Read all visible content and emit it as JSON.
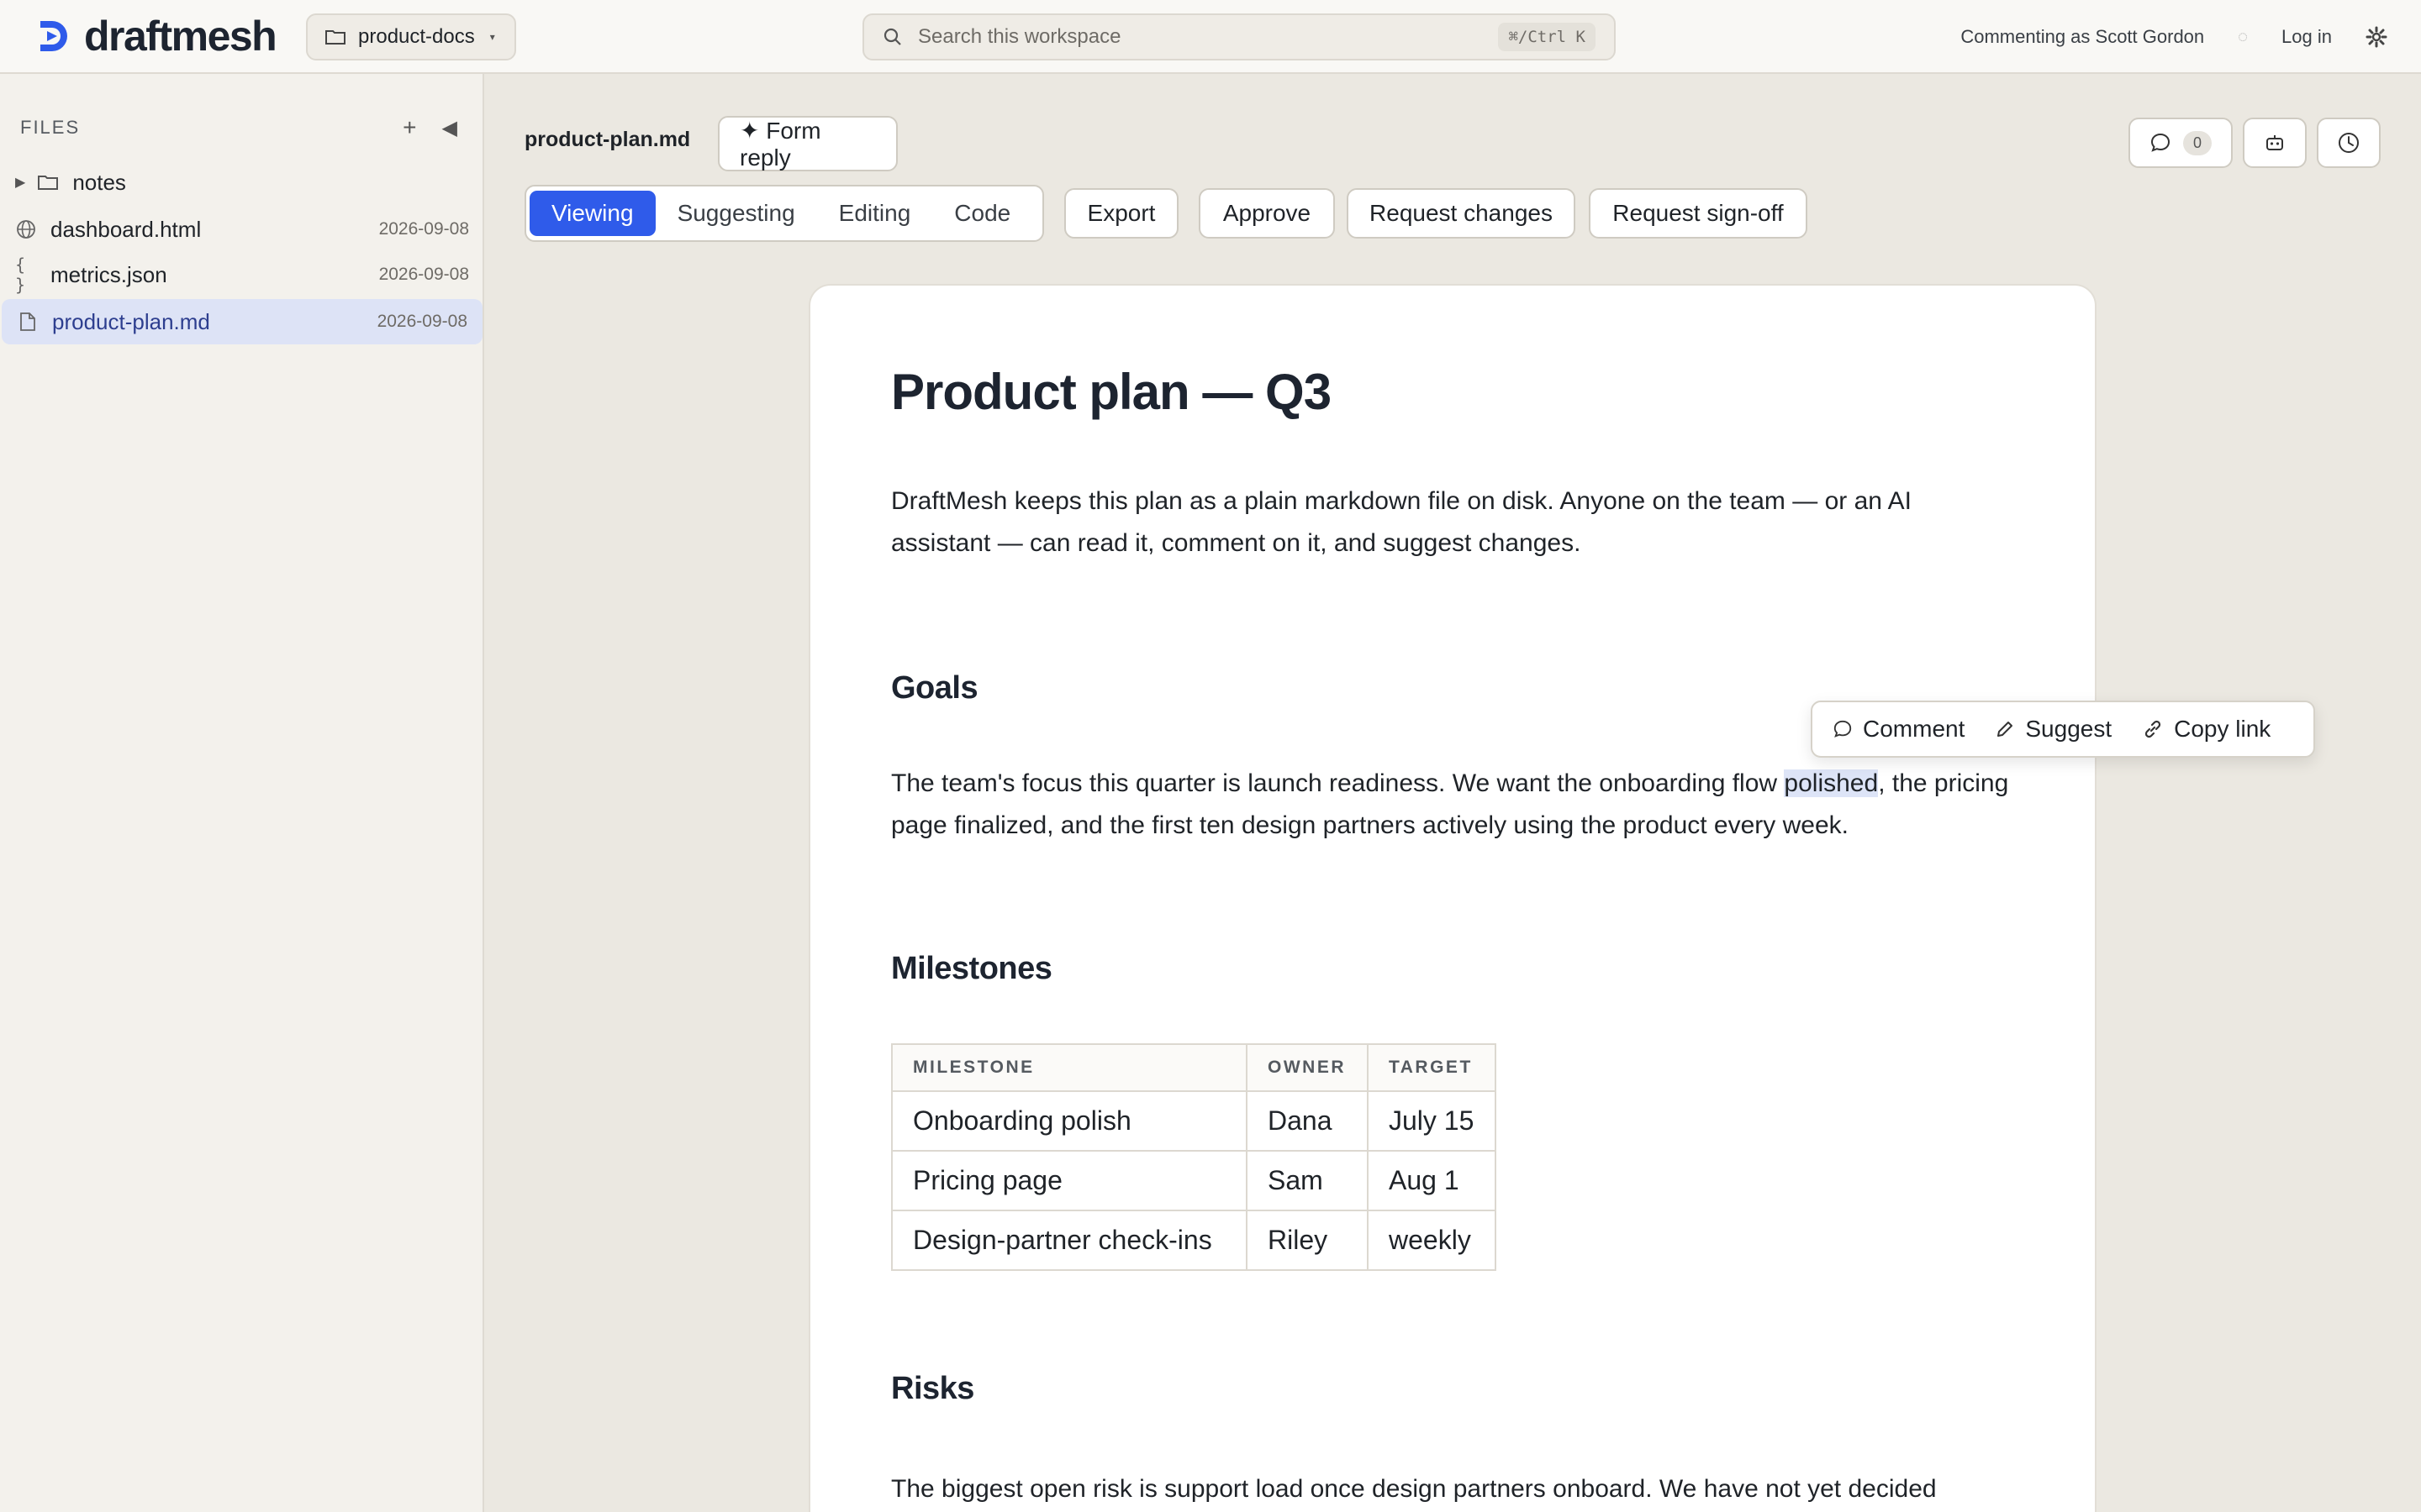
{
  "app": {
    "brand": "draftmesh",
    "workspace": "product-docs",
    "search_placeholder": "Search this workspace",
    "search_shortcut": "⌘/Ctrl K",
    "commenting_as": "Commenting as Scott Gordon",
    "login": "Log in",
    "accent": "#2f5bea"
  },
  "sidebar": {
    "title": "FILES",
    "items": [
      {
        "type": "folder",
        "name": "notes",
        "icon": "folder-icon"
      },
      {
        "type": "file",
        "name": "dashboard.html",
        "date": "2026-09-08",
        "icon": "globe-icon"
      },
      {
        "type": "file",
        "name": "metrics.json",
        "date": "2026-09-08",
        "icon": "braces-icon"
      },
      {
        "type": "file",
        "name": "product-plan.md",
        "date": "2026-09-08",
        "icon": "file-icon",
        "active": true
      }
    ]
  },
  "header": {
    "file_name": "product-plan.md",
    "form_reply": "✦ Form reply",
    "modes": [
      "Viewing",
      "Suggesting",
      "Editing",
      "Code"
    ],
    "active_mode": "Viewing",
    "actions": {
      "export": "Export",
      "approve": "Approve",
      "request_changes": "Request changes",
      "request_signoff": "Request sign-off"
    },
    "comment_count": "0"
  },
  "doc": {
    "title": "Product plan — Q3",
    "intro": "DraftMesh keeps this plan as a plain markdown file on disk. Anyone on the team — or an AI assistant — can read it, comment on it, and suggest changes.",
    "goals_heading": "Goals",
    "goals_before": "The team's focus this quarter is launch readiness. We want the onboarding flow ",
    "goals_selected": "polished",
    "goals_after": ", the pricing page finalized, and the first ten design partners actively using the product every week.",
    "milestones_heading": "Milestones",
    "table": {
      "headers": [
        "MILESTONE",
        "OWNER",
        "TARGET"
      ],
      "rows": [
        [
          "Onboarding polish",
          "Dana",
          "July 15"
        ],
        [
          "Pricing page",
          "Sam",
          "Aug 1"
        ],
        [
          "Design-partner check-ins",
          "Riley",
          "weekly"
        ]
      ]
    },
    "risks_heading": "Risks",
    "risks_text": "The biggest open risk is support load once design partners onboard. We have not yet decided"
  },
  "popover": {
    "comment": "Comment",
    "suggest": "Suggest",
    "copy_link": "Copy link"
  }
}
